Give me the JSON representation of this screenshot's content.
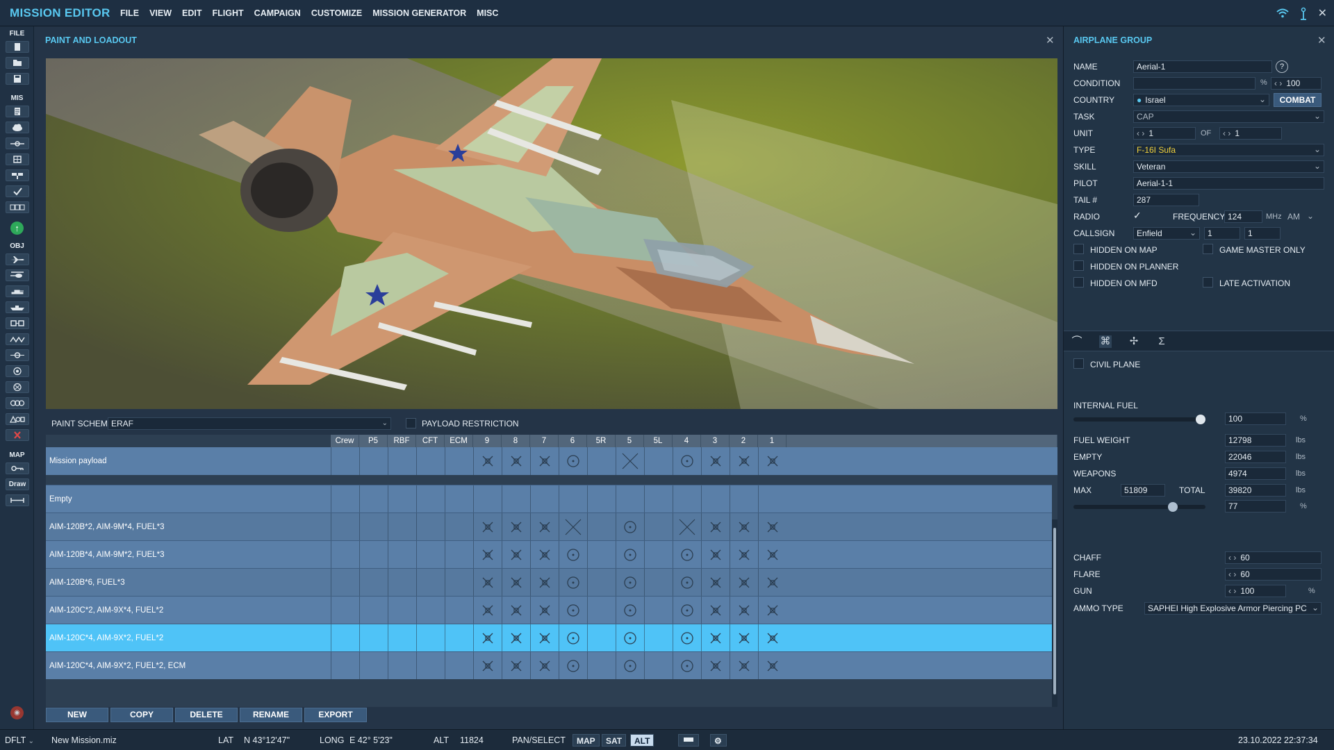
{
  "app_title": "MISSION EDITOR",
  "menu": [
    "FILE",
    "VIEW",
    "EDIT",
    "FLIGHT",
    "CAMPAIGN",
    "CUSTOMIZE",
    "MISSION GENERATOR",
    "MISC"
  ],
  "toolbar": {
    "file_label": "FILE",
    "mis_label": "MIS",
    "obj_label": "OBJ",
    "map_label": "MAP",
    "draw_label": "Draw"
  },
  "paint_panel": {
    "title": "PAINT AND LOADOUT",
    "paint_scheme_label": "PAINT SCHEME",
    "paint_scheme_value": "ERAF",
    "payload_restriction_label": "PAYLOAD RESTRICTION",
    "columns": [
      "Crew",
      "P5",
      "RBF",
      "CFT",
      "ECM",
      "9",
      "8",
      "7",
      "6",
      "5R",
      "5",
      "5L",
      "4",
      "3",
      "2",
      "1"
    ],
    "mission_payload_label": "Mission payload",
    "rows": [
      {
        "name": "Empty",
        "selected": false
      },
      {
        "name": "AIM-120B*2, AIM-9M*4, FUEL*3",
        "selected": false
      },
      {
        "name": "AIM-120B*4, AIM-9M*2, FUEL*3",
        "selected": false
      },
      {
        "name": "AIM-120B*6, FUEL*3",
        "selected": false
      },
      {
        "name": "AIM-120C*2, AIM-9X*4, FUEL*2",
        "selected": false
      },
      {
        "name": "AIM-120C*4, AIM-9X*2, FUEL*2",
        "selected": true
      },
      {
        "name": "AIM-120C*4, AIM-9X*2, FUEL*2, ECM",
        "selected": false
      }
    ],
    "buttons": {
      "new": "NEW",
      "copy": "COPY",
      "delete": "DELETE",
      "rename": "RENAME",
      "export": "EXPORT"
    }
  },
  "group_panel": {
    "title": "AIRPLANE GROUP",
    "name_label": "NAME",
    "name_value": "Aerial-1",
    "condition_label": "CONDITION",
    "condition_pct": "%",
    "condition_value": "100",
    "country_label": "COUNTRY",
    "country_value": "Israel",
    "combat_label": "COMBAT",
    "task_label": "TASK",
    "task_value": "CAP",
    "unit_label": "UNIT",
    "unit_value": "1",
    "unit_of_label": "OF",
    "unit_of_value": "1",
    "type_label": "TYPE",
    "type_value": "F-16I Sufa",
    "skill_label": "SKILL",
    "skill_value": "Veteran",
    "pilot_label": "PILOT",
    "pilot_value": "Aerial-1-1",
    "tail_label": "TAIL #",
    "tail_value": "287",
    "radio_label": "RADIO",
    "frequency_label": "FREQUENCY",
    "frequency_value": "124",
    "mhz_label": "MHz",
    "modulation_value": "AM",
    "callsign_label": "CALLSIGN",
    "callsign_value": "Enfield",
    "callsign_n1": "1",
    "callsign_n2": "1",
    "hidden_on_map": "HIDDEN ON MAP",
    "game_master_only": "GAME MASTER ONLY",
    "hidden_on_planner": "HIDDEN ON PLANNER",
    "hidden_on_mfd": "HIDDEN ON MFD",
    "late_activation": "LATE ACTIVATION",
    "civil_plane": "CIVIL PLANE",
    "internal_fuel_label": "INTERNAL FUEL",
    "internal_fuel_value": "100",
    "internal_fuel_unit": "%",
    "internal_fuel_slider": 1.0,
    "fuel_weight_label": "FUEL WEIGHT",
    "fuel_weight_value": "12798",
    "lbs": "lbs",
    "empty_label": "EMPTY",
    "empty_value": "22046",
    "weapons_label": "WEAPONS",
    "weapons_value": "4974",
    "max_label": "MAX",
    "max_value": "51809",
    "total_label": "TOTAL",
    "total_value": "39820",
    "total_pct_value": "77",
    "total_slider": 0.77,
    "chaff_label": "CHAFF",
    "chaff_value": "60",
    "flare_label": "FLARE",
    "flare_value": "60",
    "gun_label": "GUN",
    "gun_value": "100",
    "gun_unit": "%",
    "ammo_type_label": "AMMO TYPE",
    "ammo_type_value": "SAPHEI High Explosive Armor Piercing PC"
  },
  "statusbar": {
    "profile": "DFLT",
    "mission_file": "New Mission.miz",
    "lat_label": "LAT",
    "lat_value": "N 43°12'47\"",
    "long_label": "LONG",
    "long_value": "E 42° 5'23\"",
    "alt_label": "ALT",
    "alt_value": "11824",
    "mode_label": "PAN/SELECT",
    "map_btn": "MAP",
    "sat_btn": "SAT",
    "alt_btn": "ALT",
    "datetime": "23.10.2022 22:37:34"
  },
  "colors": {
    "accent": "#59c8f0",
    "selected_row": "#4fc3f7",
    "row": "#5a7fa8",
    "row_alt": "#56799f"
  }
}
